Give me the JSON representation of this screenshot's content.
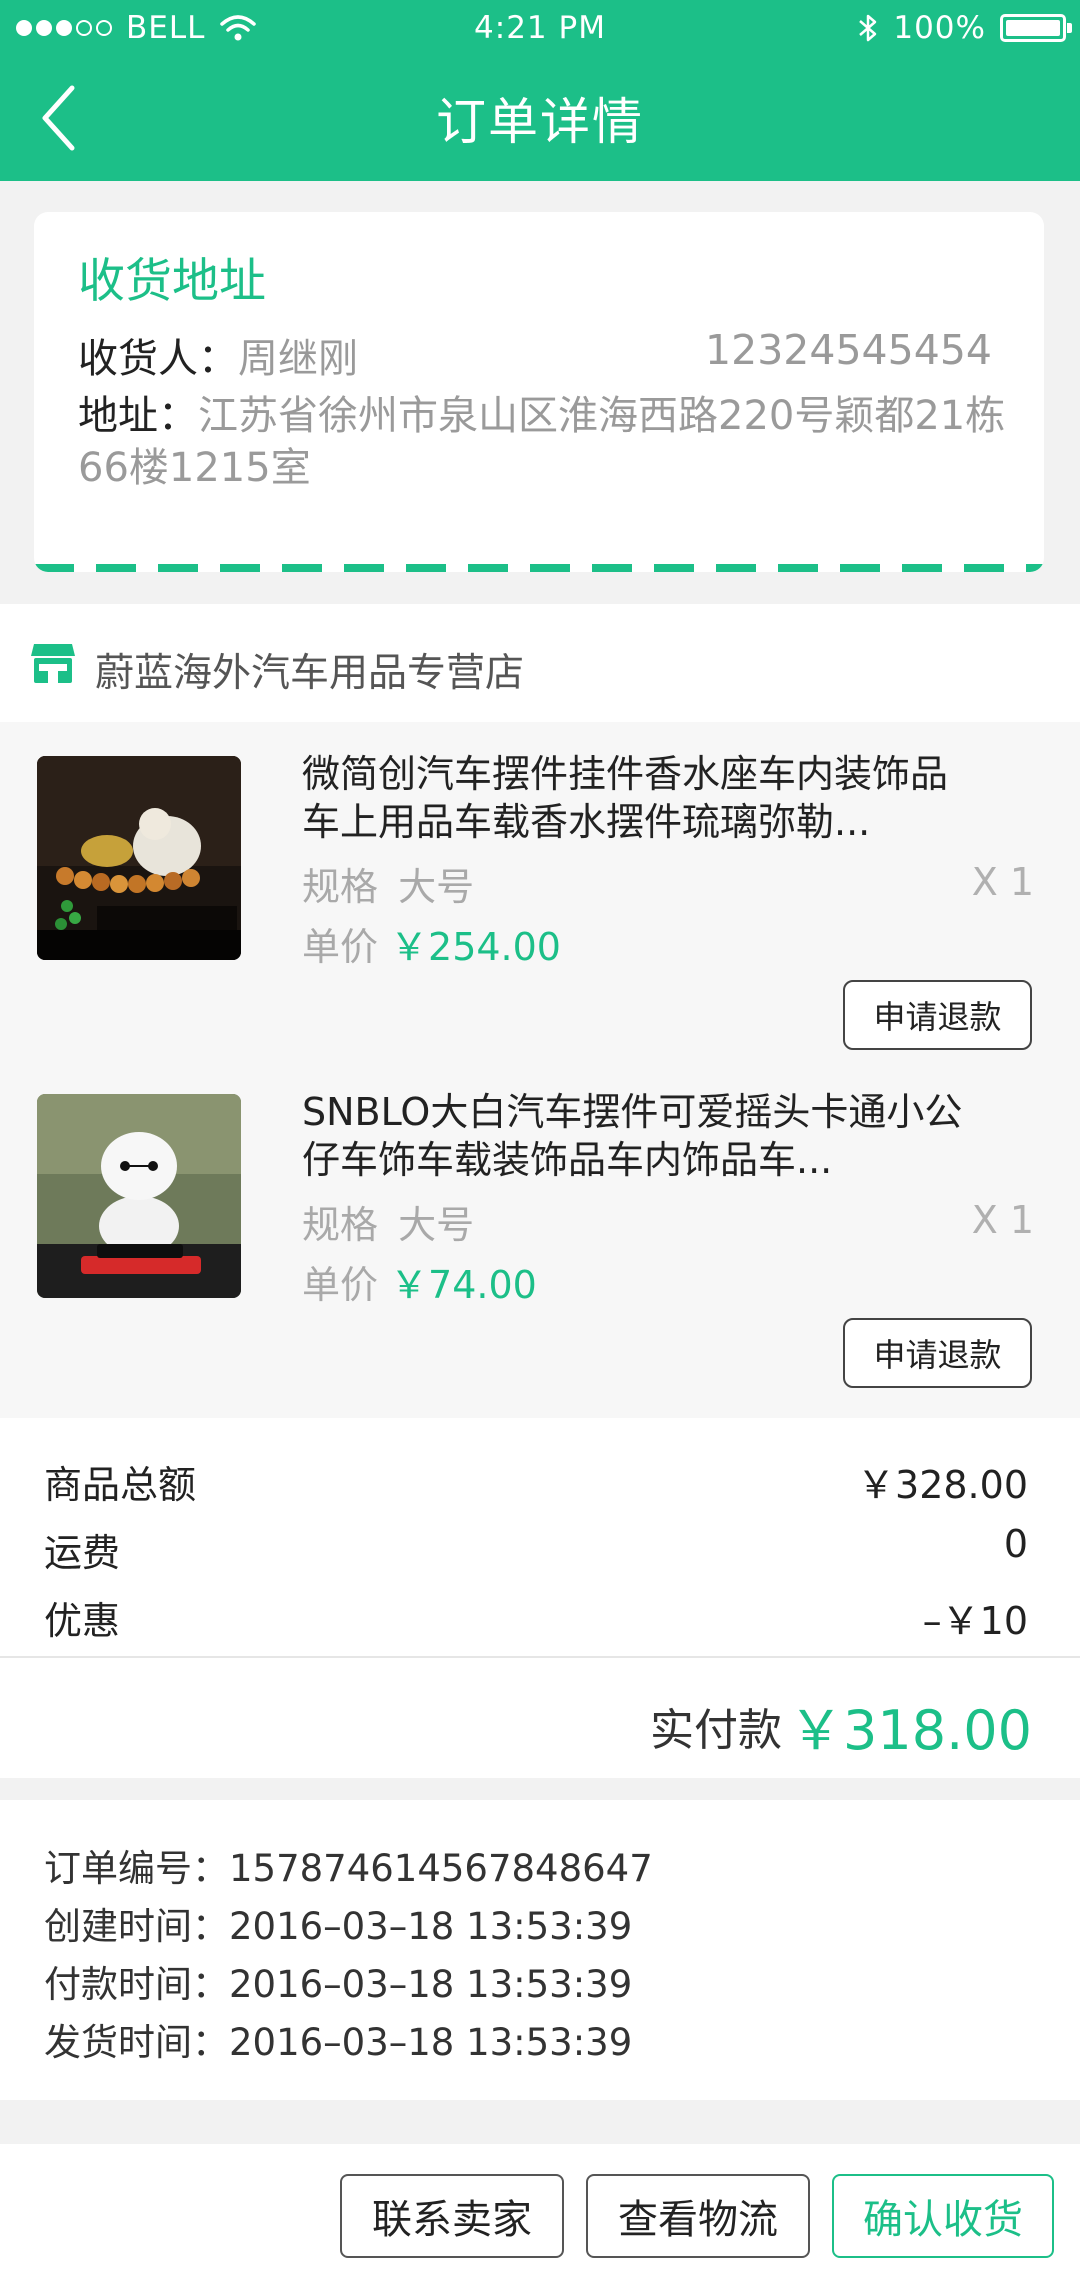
{
  "status_bar": {
    "carrier": "BELL",
    "time": "4:21 PM",
    "battery": "100%",
    "battery_level": 1.0,
    "signal_bars": 3,
    "signal_total": 5
  },
  "nav": {
    "title": "订单详情",
    "back_icon": "chevron-left-icon"
  },
  "address": {
    "section_title": "收货地址",
    "recipient_label": "收货人：",
    "recipient_name": "周继刚",
    "phone": "12324545454",
    "address_label": "地址：",
    "address_text": "江苏省徐州市泉山区淮海西路220号颖都21栋66楼1215室"
  },
  "shop": {
    "name": "蔚蓝海外汽车用品专营店",
    "icon": "store-icon"
  },
  "products": [
    {
      "title": "微简创汽车摆件挂件香水座车内装饰品车上用品车载香水摆件琉璃弥勒...",
      "spec_label": "规格",
      "spec_value": "大号",
      "quantity": "X 1",
      "price_label": "单价",
      "price": "￥254.00",
      "refund_label": "申请退款"
    },
    {
      "title": "SNBLO大白汽车摆件可爱摇头卡通小公仔车饰车载装饰品车内饰品车...",
      "spec_label": "规格",
      "spec_value": "大号",
      "quantity": "X 1",
      "price_label": "单价",
      "price": "￥74.00",
      "refund_label": "申请退款"
    }
  ],
  "summary": {
    "subtotal_label": "商品总额",
    "subtotal": "￥328.00",
    "shipping_label": "运费",
    "shipping": "0",
    "discount_label": "优惠",
    "discount": "–￥10",
    "paid_label": "实付款",
    "paid": "￥318.00"
  },
  "order_info": {
    "order_no_label": "订单编号：",
    "order_no": "157874614567848647",
    "created_label": "创建时间：",
    "created": "2016–03–18 13:53:39",
    "paid_label": "付款时间：",
    "paid": "2016–03–18 13:53:39",
    "shipped_label": "发货时间：",
    "shipped": "2016–03–18 13:53:39"
  },
  "actions": {
    "contact_seller": "联系卖家",
    "view_logistics": "查看物流",
    "confirm_receipt": "确认收货"
  },
  "colors": {
    "accent": "#1cbf88",
    "background": "#f2f2f2"
  }
}
